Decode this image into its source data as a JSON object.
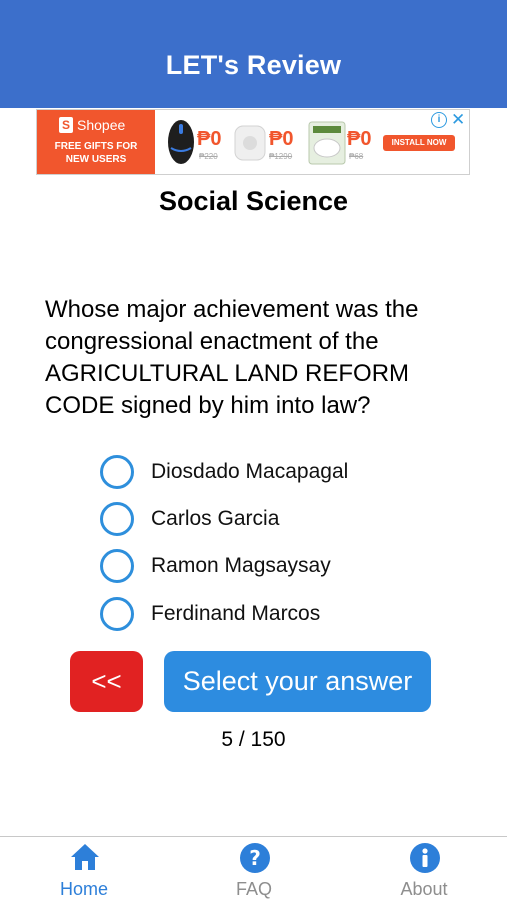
{
  "header": {
    "title": "LET's Review"
  },
  "ad": {
    "brand": "Shopee",
    "tagline_line1": "FREE GIFTS FOR",
    "tagline_line2": "NEW USERS",
    "products": [
      {
        "name": "mouse",
        "price": "₱0",
        "old_price": "₱220"
      },
      {
        "name": "speaker",
        "price": "₱0",
        "old_price": "₱1290"
      },
      {
        "name": "rice pack",
        "price": "₱0",
        "old_price": "₱68"
      }
    ],
    "install_label": "INSTALL NOW",
    "info_icon": "info-icon",
    "close_icon": "close-icon",
    "accent_color": "#f1562d"
  },
  "subject": "Social Science",
  "question": "Whose major achievement was the congressional enactment of the AGRICULTURAL LAND REFORM CODE signed by him into law?",
  "options": [
    {
      "label": "Diosdado Macapagal"
    },
    {
      "label": "Carlos Garcia"
    },
    {
      "label": "Ramon Magsaysay"
    },
    {
      "label": "Ferdinand Marcos"
    }
  ],
  "buttons": {
    "back_label": "<<",
    "answer_label": "Select your answer"
  },
  "progress": "5 / 150",
  "tabs": [
    {
      "label": "Home",
      "icon": "home-icon",
      "active": true
    },
    {
      "label": "FAQ",
      "icon": "question-circle-icon",
      "active": false
    },
    {
      "label": "About",
      "icon": "info-circle-icon",
      "active": false
    }
  ],
  "colors": {
    "header": "#3c6fcb",
    "primary": "#2d8ce0",
    "danger": "#e12222",
    "tab_active": "#2d7fd9"
  }
}
